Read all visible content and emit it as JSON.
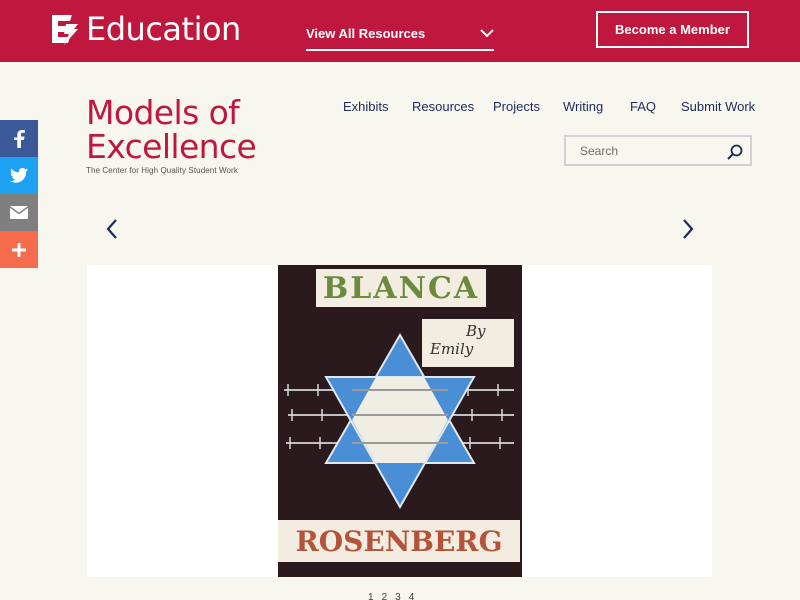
{
  "topbar": {
    "brand_mark": "EL",
    "brand_text": "Education",
    "view_all_label": "View All Resources",
    "member_button": "Become a Member",
    "bg_color": "#c0173f"
  },
  "social": [
    {
      "name": "facebook",
      "icon": "facebook-icon",
      "color": "#3b5998"
    },
    {
      "name": "twitter",
      "icon": "twitter-icon",
      "color": "#1da1f2"
    },
    {
      "name": "email",
      "icon": "mail-icon",
      "color": "#7f7f7f"
    },
    {
      "name": "share",
      "icon": "plus-icon",
      "color": "#f76b4d"
    }
  ],
  "site": {
    "title_line1": "Models of",
    "title_line2": "Excellence",
    "tagline": "The Center for High Quality Student Work"
  },
  "nav": {
    "items": [
      {
        "label": "Exhibits"
      },
      {
        "label": "Resources"
      },
      {
        "label": "Projects"
      },
      {
        "label": "Writing"
      },
      {
        "label": "FAQ"
      },
      {
        "label": "Submit Work"
      }
    ]
  },
  "search": {
    "placeholder": "Search",
    "value": ""
  },
  "slide": {
    "top_text": "BLANCA",
    "by_line1": "By",
    "by_line2": "Emily",
    "bottom_text": "ROSENBERG"
  },
  "pagination": [
    "1",
    "2",
    "3",
    "4"
  ]
}
